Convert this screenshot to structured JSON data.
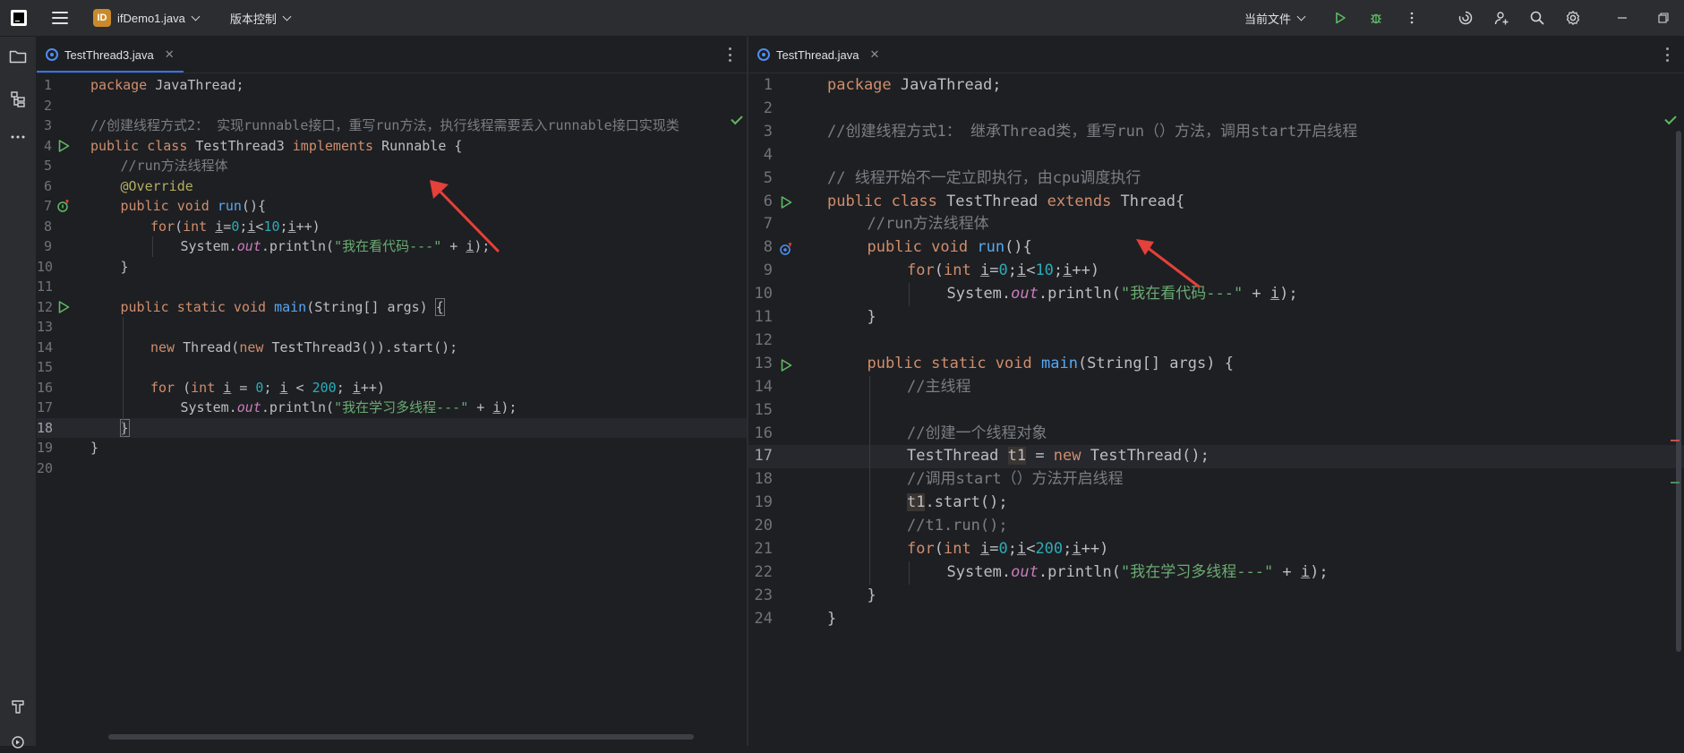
{
  "titlebar": {
    "project_badge": "ID",
    "project_name": "ifDemo1.java",
    "vcs_label": "版本控制",
    "run_config": "当前文件"
  },
  "colors": {
    "accent": "#3574f0",
    "keyword": "#cf8e6d",
    "comment": "#7a7e85",
    "string": "#6aab73",
    "number": "#2aacb8",
    "method": "#56a8f5",
    "static_field": "#c77dbb",
    "annotation": "#b3ae60",
    "run_icon": "#5fb865",
    "arrow": "#e5403a"
  },
  "icons": {
    "menu": "hamburger-icon",
    "run": "run-icon",
    "debug": "debug-icon",
    "more": "more-vertical-icon",
    "ai": "ai-assistant-icon",
    "add_user": "code-with-me-icon",
    "search": "search-icon",
    "settings": "gear-icon",
    "minimize": "minimize-icon",
    "restore": "restore-icon",
    "project": "folder-icon",
    "structure": "structure-icon",
    "more_tools": "more-horizontal-icon",
    "build": "build-icon"
  },
  "left_editor": {
    "tab_label": "TestThread3.java",
    "lines": [
      {
        "n": "1"
      },
      {
        "n": "2"
      },
      {
        "n": "3"
      },
      {
        "n": "4"
      },
      {
        "n": "5"
      },
      {
        "n": "6"
      },
      {
        "n": "7"
      },
      {
        "n": "8"
      },
      {
        "n": "9"
      },
      {
        "n": "10"
      },
      {
        "n": "11"
      },
      {
        "n": "12"
      },
      {
        "n": "13"
      },
      {
        "n": "14"
      },
      {
        "n": "15"
      },
      {
        "n": "16"
      },
      {
        "n": "17"
      },
      {
        "n": "18"
      },
      {
        "n": "19"
      },
      {
        "n": "20"
      }
    ],
    "code": {
      "l1_kw": "package",
      "l1_rest": " JavaThread;",
      "l3": "//创建线程方式2： 实现runnable接口，重写run方法，执行线程需要丢入runnable接口实现类",
      "l4_kw": "public class",
      "l4_name": " TestThread3 ",
      "l4_kw2": "implements",
      "l4_rest": " Runnable {",
      "l5": "//run方法线程体",
      "l6": "@Override",
      "l7_kw": "public void",
      "l7_fn": "run",
      "l7_rest": "(){",
      "l8_kw": "for",
      "l8_a": "(",
      "l8_kw2": "int",
      "l8_i1": "i",
      "l8_b": "=",
      "l8_n0": "0",
      "l8_c": ";",
      "l8_i2": "i",
      "l8_d": "<",
      "l8_n10": "10",
      "l8_e": ";",
      "l8_i3": "i",
      "l8_f": "++)",
      "l9_a": "System.",
      "l9_out": "out",
      "l9_b": ".println(",
      "l9_s": "\"我在看代码---\"",
      "l9_c": " + ",
      "l9_i": "i",
      "l9_d": ");",
      "l10": "}",
      "l12_kw": "public static void",
      "l12_fn": "main",
      "l12_rest": "(String[] args) ",
      "l12_brace": "{",
      "l14_kw": "new",
      "l14_a": " Thread(",
      "l14_kw2": "new",
      "l14_b": " TestThread3()).start();",
      "l16_kw": "for",
      "l16_a": " (",
      "l16_kw2": "int",
      "l16_i1": "i",
      "l16_b": " = ",
      "l16_n0": "0",
      "l16_c": "; ",
      "l16_i2": "i",
      "l16_d": " < ",
      "l16_n": "200",
      "l16_e": "; ",
      "l16_i3": "i",
      "l16_f": "++)",
      "l17_a": "System.",
      "l17_out": "out",
      "l17_b": ".println(",
      "l17_s": "\"我在学习多线程---\"",
      "l17_c": " + ",
      "l17_i": "i",
      "l17_d": ");",
      "l18": "}",
      "l19": "}"
    }
  },
  "right_editor": {
    "tab_label": "TestThread.java",
    "lines": [
      {
        "n": "1"
      },
      {
        "n": "2"
      },
      {
        "n": "3"
      },
      {
        "n": "4"
      },
      {
        "n": "5"
      },
      {
        "n": "6"
      },
      {
        "n": "7"
      },
      {
        "n": "8"
      },
      {
        "n": "9"
      },
      {
        "n": "10"
      },
      {
        "n": "11"
      },
      {
        "n": "12"
      },
      {
        "n": "13"
      },
      {
        "n": "14"
      },
      {
        "n": "15"
      },
      {
        "n": "16"
      },
      {
        "n": "17"
      },
      {
        "n": "18"
      },
      {
        "n": "19"
      },
      {
        "n": "20"
      },
      {
        "n": "21"
      },
      {
        "n": "22"
      },
      {
        "n": "23"
      },
      {
        "n": "24"
      }
    ],
    "code": {
      "l1_kw": "package",
      "l1_rest": " JavaThread;",
      "l3": "//创建线程方式1： 继承Thread类，重写run（）方法，调用start开启线程",
      "l5": "// 线程开始不一定立即执行，由cpu调度执行",
      "l6_kw": "public class",
      "l6_name": " TestThread ",
      "l6_kw2": "extends",
      "l6_rest": " Thread{",
      "l7": "//run方法线程体",
      "l8_kw": "public void",
      "l8_fn": "run",
      "l8_rest": "(){",
      "l9_kw": "for",
      "l9_a": "(",
      "l9_kw2": "int",
      "l9_i1": "i",
      "l9_b": "=",
      "l9_n0": "0",
      "l9_c": ";",
      "l9_i2": "i",
      "l9_d": "<",
      "l9_n10": "10",
      "l9_e": ";",
      "l9_i3": "i",
      "l9_f": "++)",
      "l10_a": "System.",
      "l10_out": "out",
      "l10_b": ".println(",
      "l10_s": "\"我在看代码---\"",
      "l10_c": " + ",
      "l10_i": "i",
      "l10_d": ");",
      "l11": "}",
      "l13_kw": "public static void",
      "l13_fn": "main",
      "l13_rest": "(String[] args) {",
      "l14": "//主线程",
      "l16": "//创建一个线程对象",
      "l17_a": "TestThread ",
      "l17_var": "t1",
      "l17_b": " = ",
      "l17_kw": "new",
      "l17_c": " TestThread();",
      "l18": "//调用start（）方法开启线程",
      "l19_var": "t1",
      "l19_rest": ".start();",
      "l20": "//t1.run();",
      "l21_kw": "for",
      "l21_a": "(",
      "l21_kw2": "int",
      "l21_i1": "i",
      "l21_b": "=",
      "l21_n0": "0",
      "l21_c": ";",
      "l21_i2": "i",
      "l21_d": "<",
      "l21_n": "200",
      "l21_e": ";",
      "l21_i3": "i",
      "l21_f": "++)",
      "l22_a": "System.",
      "l22_out": "out",
      "l22_b": ".println(",
      "l22_s": "\"我在学习多线程---\"",
      "l22_c": " + ",
      "l22_i": "i",
      "l22_d": ");",
      "l23": "}",
      "l24": "}"
    }
  }
}
